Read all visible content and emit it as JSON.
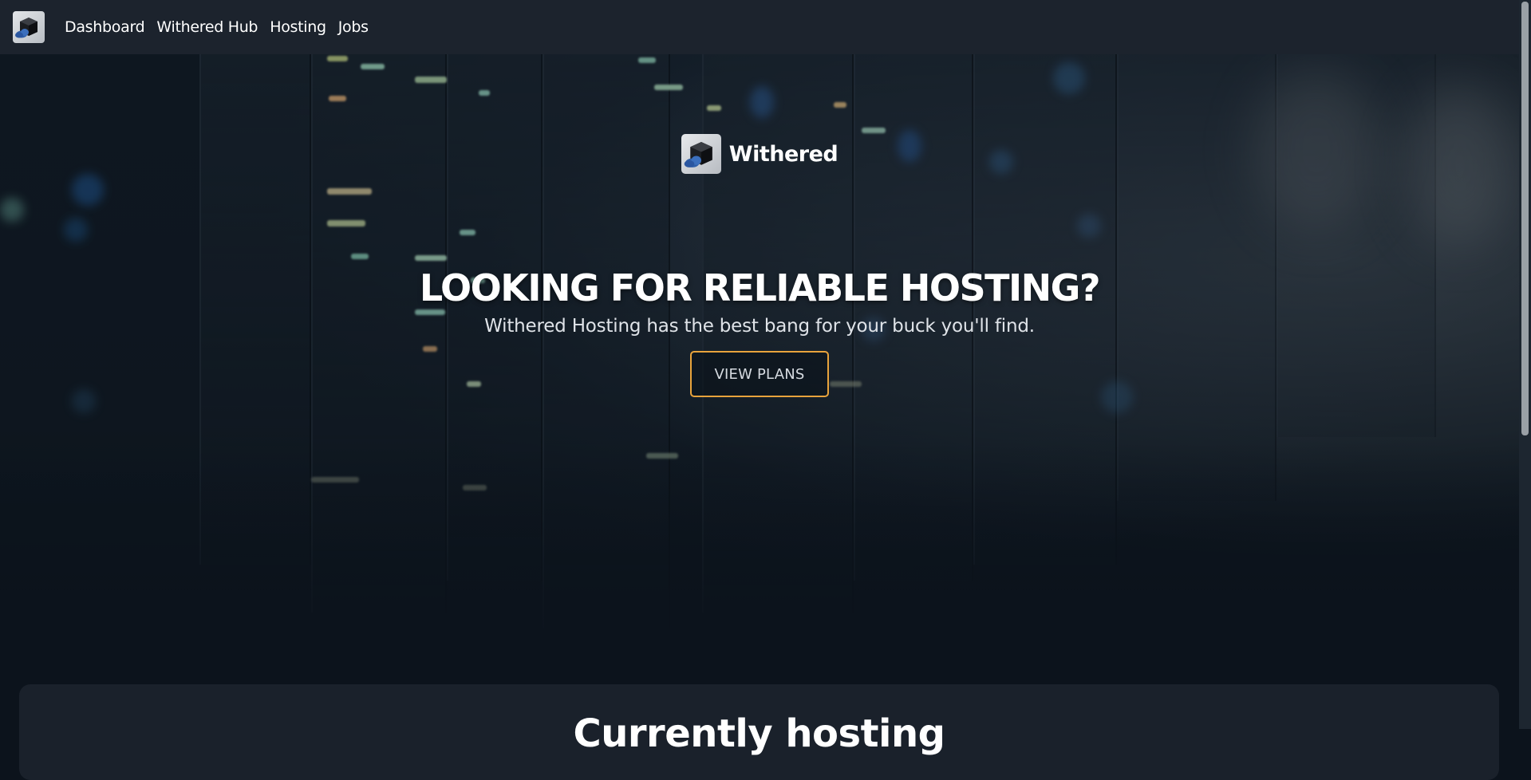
{
  "navbar": {
    "logo_icon": "withered-cube-cloud-logo",
    "links": [
      {
        "label": "Dashboard"
      },
      {
        "label": "Withered Hub"
      },
      {
        "label": "Hosting"
      },
      {
        "label": "Jobs"
      }
    ]
  },
  "hero": {
    "brand_name": "Withered",
    "title": "LOOKING FOR RELIABLE HOSTING?",
    "subtitle": "Withered Hosting has the best bang for your buck you'll find.",
    "cta_label": "VIEW PLANS",
    "cta_border_color": "#e8a33c",
    "background": "server-rack-photo"
  },
  "section": {
    "title": "Currently hosting"
  },
  "colors": {
    "navbar_bg": "#1c232d",
    "page_bg": "#0c131c",
    "card_bg": "#1a212b",
    "accent": "#e8a33c"
  }
}
